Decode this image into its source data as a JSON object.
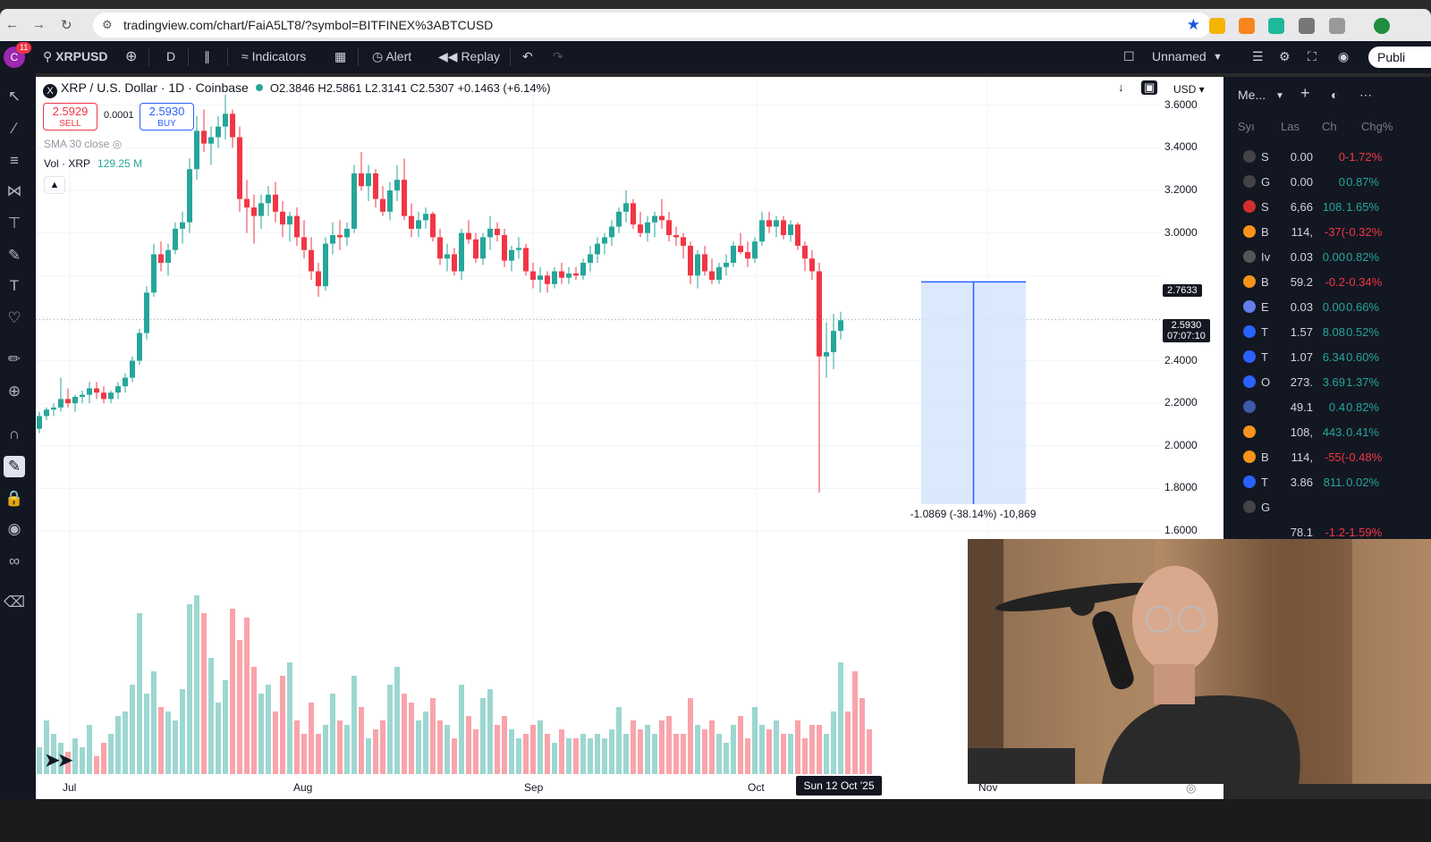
{
  "browser": {
    "url": "tradingview.com/chart/FaiA5LT8/?symbol=BITFINEX%3ABTCUSD",
    "back_icon": "back-arrow-icon",
    "forward_icon": "forward-arrow-icon",
    "reload_icon": "reload-icon"
  },
  "toolbar": {
    "avatar_letter": "C",
    "notifications": "11",
    "symbol": "XRPUSD",
    "interval": "D",
    "indicators_label": "Indicators",
    "alert_label": "Alert",
    "replay_label": "Replay",
    "layout_name": "Unnamed",
    "publish_label": "Publi"
  },
  "legend": {
    "title": "XRP / U.S. Dollar · 1D · Coinbase",
    "logo_letter": "X",
    "ohlc": "O2.3846  H2.5861  L2.3141  C2.5307  +0.1463 (+6.14%)",
    "sell_price": "2.5929",
    "sell_label": "SELL",
    "spread": "0.0001",
    "buy_price": "2.5930",
    "buy_label": "BUY",
    "sma_label": "SMA 30 close",
    "vol_label": "Vol · XRP",
    "vol_value": "129.25 M"
  },
  "price_axis": {
    "currency": "USD",
    "labels": [
      "3.6000",
      "3.4000",
      "3.2000",
      "3.0000",
      "2.4000",
      "2.2000",
      "2.0000",
      "1.8000",
      "1.6000"
    ],
    "marker_price": "2.7633",
    "current_price": "2.5930",
    "countdown": "07:07:10"
  },
  "time_axis": {
    "labels": [
      "Jul",
      "Aug",
      "Sep",
      "Oct",
      "Nov"
    ],
    "crosshair_date": "Sun 12 Oct '25"
  },
  "measure": {
    "label": "-1.0869 (-38.14%) -10,869"
  },
  "chart_data": {
    "type": "candlestick",
    "symbol": "XRPUSD",
    "timeframe": "1D",
    "x_axis": [
      "Jul",
      "Aug",
      "Sep",
      "Oct",
      "Nov"
    ],
    "ylim": [
      1.6,
      3.7
    ],
    "candles": [
      [
        2.08,
        2.16,
        2.06,
        2.14
      ],
      [
        2.14,
        2.18,
        2.12,
        2.17
      ],
      [
        2.17,
        2.2,
        2.14,
        2.18
      ],
      [
        2.18,
        2.32,
        2.16,
        2.22
      ],
      [
        2.22,
        2.27,
        2.18,
        2.2
      ],
      [
        2.2,
        2.24,
        2.16,
        2.23
      ],
      [
        2.23,
        2.26,
        2.2,
        2.24
      ],
      [
        2.24,
        2.3,
        2.2,
        2.27
      ],
      [
        2.27,
        2.3,
        2.22,
        2.25
      ],
      [
        2.25,
        2.28,
        2.2,
        2.22
      ],
      [
        2.22,
        2.26,
        2.2,
        2.25
      ],
      [
        2.25,
        2.3,
        2.22,
        2.28
      ],
      [
        2.28,
        2.34,
        2.25,
        2.32
      ],
      [
        2.32,
        2.42,
        2.3,
        2.4
      ],
      [
        2.4,
        2.55,
        2.38,
        2.53
      ],
      [
        2.53,
        2.75,
        2.5,
        2.72
      ],
      [
        2.72,
        2.95,
        2.7,
        2.9
      ],
      [
        2.9,
        2.96,
        2.82,
        2.86
      ],
      [
        2.86,
        2.95,
        2.8,
        2.92
      ],
      [
        2.92,
        3.05,
        2.9,
        3.02
      ],
      [
        3.02,
        3.1,
        2.95,
        3.05
      ],
      [
        3.05,
        3.35,
        3.0,
        3.3
      ],
      [
        3.3,
        3.55,
        3.25,
        3.48
      ],
      [
        3.48,
        3.58,
        3.38,
        3.42
      ],
      [
        3.42,
        3.5,
        3.32,
        3.45
      ],
      [
        3.45,
        3.55,
        3.4,
        3.5
      ],
      [
        3.5,
        3.65,
        3.44,
        3.56
      ],
      [
        3.56,
        3.58,
        3.4,
        3.45
      ],
      [
        3.45,
        3.5,
        3.1,
        3.16
      ],
      [
        3.16,
        3.25,
        3.0,
        3.12
      ],
      [
        3.12,
        3.18,
        2.95,
        3.08
      ],
      [
        3.08,
        3.18,
        3.02,
        3.14
      ],
      [
        3.14,
        3.22,
        3.08,
        3.18
      ],
      [
        3.18,
        3.24,
        3.05,
        3.1
      ],
      [
        3.1,
        3.15,
        2.98,
        3.04
      ],
      [
        3.04,
        3.1,
        2.96,
        3.08
      ],
      [
        3.08,
        3.12,
        2.94,
        2.98
      ],
      [
        2.98,
        3.06,
        2.88,
        2.92
      ],
      [
        2.92,
        2.98,
        2.78,
        2.82
      ],
      [
        2.82,
        2.86,
        2.7,
        2.75
      ],
      [
        2.75,
        2.98,
        2.73,
        2.95
      ],
      [
        2.95,
        3.05,
        2.9,
        2.99
      ],
      [
        2.99,
        3.06,
        2.92,
        2.98
      ],
      [
        2.98,
        3.05,
        2.94,
        3.02
      ],
      [
        3.02,
        3.32,
        3.0,
        3.28
      ],
      [
        3.28,
        3.38,
        3.2,
        3.22
      ],
      [
        3.22,
        3.32,
        3.15,
        3.28
      ],
      [
        3.28,
        3.3,
        3.12,
        3.16
      ],
      [
        3.16,
        3.22,
        3.08,
        3.1
      ],
      [
        3.1,
        3.24,
        3.06,
        3.2
      ],
      [
        3.2,
        3.32,
        3.15,
        3.25
      ],
      [
        3.25,
        3.35,
        3.06,
        3.08
      ],
      [
        3.08,
        3.14,
        2.98,
        3.02
      ],
      [
        3.02,
        3.1,
        2.98,
        3.06
      ],
      [
        3.06,
        3.12,
        3.02,
        3.09
      ],
      [
        3.09,
        3.1,
        2.96,
        2.98
      ],
      [
        2.98,
        3.02,
        2.85,
        2.88
      ],
      [
        2.88,
        2.95,
        2.82,
        2.9
      ],
      [
        2.9,
        2.93,
        2.8,
        2.82
      ],
      [
        2.82,
        3.02,
        2.78,
        3.0
      ],
      [
        3.0,
        3.06,
        2.95,
        2.97
      ],
      [
        2.97,
        3.0,
        2.86,
        2.88
      ],
      [
        2.88,
        3.0,
        2.85,
        2.98
      ],
      [
        2.98,
        3.08,
        2.92,
        3.02
      ],
      [
        3.02,
        3.05,
        2.96,
        2.99
      ],
      [
        2.99,
        3.02,
        2.84,
        2.87
      ],
      [
        2.87,
        2.94,
        2.82,
        2.92
      ],
      [
        2.92,
        2.98,
        2.88,
        2.93
      ],
      [
        2.93,
        2.95,
        2.8,
        2.82
      ],
      [
        2.82,
        2.86,
        2.74,
        2.78
      ],
      [
        2.78,
        2.84,
        2.72,
        2.8
      ],
      [
        2.8,
        2.82,
        2.72,
        2.76
      ],
      [
        2.76,
        2.84,
        2.74,
        2.82
      ],
      [
        2.82,
        2.86,
        2.76,
        2.79
      ],
      [
        2.79,
        2.84,
        2.76,
        2.81
      ],
      [
        2.81,
        2.84,
        2.78,
        2.8
      ],
      [
        2.8,
        2.88,
        2.78,
        2.86
      ],
      [
        2.86,
        2.94,
        2.82,
        2.9
      ],
      [
        2.9,
        2.98,
        2.86,
        2.95
      ],
      [
        2.95,
        3.0,
        2.9,
        2.98
      ],
      [
        2.98,
        3.06,
        2.94,
        3.03
      ],
      [
        3.03,
        3.12,
        3.0,
        3.1
      ],
      [
        3.1,
        3.2,
        3.05,
        3.14
      ],
      [
        3.14,
        3.16,
        3.02,
        3.04
      ],
      [
        3.04,
        3.1,
        2.98,
        3.0
      ],
      [
        3.0,
        3.08,
        2.96,
        3.05
      ],
      [
        3.05,
        3.1,
        2.98,
        3.08
      ],
      [
        3.08,
        3.16,
        3.02,
        3.06
      ],
      [
        3.06,
        3.1,
        2.96,
        2.99
      ],
      [
        2.99,
        3.03,
        2.94,
        2.98
      ],
      [
        2.98,
        3.0,
        2.88,
        2.94
      ],
      [
        2.94,
        2.96,
        2.76,
        2.8
      ],
      [
        2.8,
        2.92,
        2.74,
        2.9
      ],
      [
        2.9,
        2.94,
        2.8,
        2.82
      ],
      [
        2.82,
        2.88,
        2.76,
        2.78
      ],
      [
        2.78,
        2.86,
        2.76,
        2.84
      ],
      [
        2.84,
        2.9,
        2.8,
        2.86
      ],
      [
        2.86,
        2.96,
        2.84,
        2.94
      ],
      [
        2.94,
        3.0,
        2.9,
        2.91
      ],
      [
        2.91,
        2.96,
        2.84,
        2.88
      ],
      [
        2.88,
        2.98,
        2.86,
        2.96
      ],
      [
        2.96,
        3.1,
        2.94,
        3.06
      ],
      [
        3.06,
        3.1,
        3.0,
        3.03
      ],
      [
        3.03,
        3.08,
        2.98,
        3.06
      ],
      [
        3.06,
        3.08,
        2.97,
        2.99
      ],
      [
        2.99,
        3.06,
        2.96,
        3.04
      ],
      [
        3.04,
        3.05,
        2.92,
        2.94
      ],
      [
        2.94,
        2.96,
        2.82,
        2.88
      ],
      [
        2.88,
        2.92,
        2.78,
        2.82
      ],
      [
        2.82,
        2.86,
        1.78,
        2.42
      ],
      [
        2.42,
        2.58,
        2.32,
        2.44
      ],
      [
        2.44,
        2.62,
        2.36,
        2.54
      ],
      [
        2.54,
        2.63,
        2.5,
        2.59
      ]
    ],
    "volume": [
      30,
      60,
      45,
      35,
      25,
      40,
      30,
      55,
      20,
      35,
      45,
      65,
      70,
      100,
      180,
      90,
      115,
      75,
      70,
      60,
      95,
      190,
      200,
      180,
      130,
      80,
      105,
      185,
      150,
      175,
      120,
      90,
      100,
      70,
      110,
      125,
      60,
      45,
      80,
      45,
      55,
      90,
      60,
      55,
      110,
      75,
      40,
      50,
      60,
      100,
      120,
      90,
      80,
      60,
      70,
      85,
      60,
      55,
      40,
      100,
      65,
      50,
      85,
      95,
      55,
      65,
      50,
      40,
      45,
      55,
      60,
      45,
      35,
      50,
      40,
      40,
      45,
      40,
      45,
      40,
      50,
      75,
      45,
      60,
      50,
      55,
      45,
      60,
      65,
      45,
      45,
      85,
      55,
      50,
      60,
      45,
      35,
      55,
      65,
      40,
      75,
      55,
      50,
      60,
      45,
      45,
      60,
      40,
      55,
      55,
      45,
      70,
      125,
      70,
      115,
      85,
      50
    ],
    "measure": {
      "from": 2.77,
      "to": 1.68,
      "change": -1.0869,
      "change_pct": -38.14,
      "ticks": -10869
    }
  },
  "watchlist": {
    "title": "Me...",
    "columns": [
      "Syı",
      "Las",
      "Ch",
      "Chg%"
    ],
    "rows": [
      {
        "sym": "S",
        "last": "0.00",
        "chg": "0",
        "pct": "-1.72%",
        "dir": "neg",
        "icon_color": "#444444"
      },
      {
        "sym": "G",
        "last": "0.00",
        "chg": "0",
        "pct": "0.87%",
        "dir": "pos",
        "icon_color": "#444444"
      },
      {
        "sym": "S",
        "last": "6,66",
        "chg": "108.",
        "pct": "1.65%",
        "dir": "pos",
        "icon_color": "#d32f2f"
      },
      {
        "sym": "B",
        "last": "114,",
        "chg": "-37(",
        "pct": "-0.32%",
        "dir": "neg",
        "icon_color": "#f7931a"
      },
      {
        "sym": "Iv",
        "last": "0.03",
        "chg": "0.00",
        "pct": "0.82%",
        "dir": "pos",
        "icon_color": "#555555"
      },
      {
        "sym": "B",
        "last": "59.2",
        "chg": "-0.2",
        "pct": "-0.34%",
        "dir": "neg",
        "icon_color": "#f7931a"
      },
      {
        "sym": "E",
        "last": "0.03",
        "chg": "0.00",
        "pct": "0.66%",
        "dir": "pos",
        "icon_color": "#627eea"
      },
      {
        "sym": "T",
        "last": "1.57",
        "chg": "8.08",
        "pct": "0.52%",
        "dir": "pos",
        "icon_color": "#2962ff"
      },
      {
        "sym": "T",
        "last": "1.07",
        "chg": "6.34",
        "pct": "0.60%",
        "dir": "pos",
        "icon_color": "#2962ff"
      },
      {
        "sym": "O",
        "last": "273.",
        "chg": "3.69",
        "pct": "1.37%",
        "dir": "pos",
        "icon_color": "#2962ff"
      },
      {
        "sym": "",
        "last": "49.1",
        "chg": "0.4",
        "pct": "0.82%",
        "dir": "pos",
        "icon_color": "#3c5aa6"
      },
      {
        "sym": "",
        "last": "108,",
        "chg": "443.",
        "pct": "0.41%",
        "dir": "pos",
        "icon_color": "#f7931a"
      },
      {
        "sym": "B",
        "last": "114,",
        "chg": "-55(",
        "pct": "-0.48%",
        "dir": "neg",
        "icon_color": "#f7931a"
      },
      {
        "sym": "T",
        "last": "3.86",
        "chg": "811.",
        "pct": "0.02%",
        "dir": "pos",
        "icon_color": "#2962ff"
      },
      {
        "sym": "G",
        "last": "",
        "chg": "",
        "pct": "",
        "dir": "neg",
        "icon_color": "#444444"
      },
      {
        "sym": "",
        "last": "78.1",
        "chg": "-1.2",
        "pct": "-1.59%",
        "dir": "neg",
        "icon_color": "#131722"
      }
    ]
  },
  "colors": {
    "up": "#26a69a",
    "down": "#f23645",
    "measure_fill": "#d6e4fb",
    "measure_line": "#2962ff"
  }
}
